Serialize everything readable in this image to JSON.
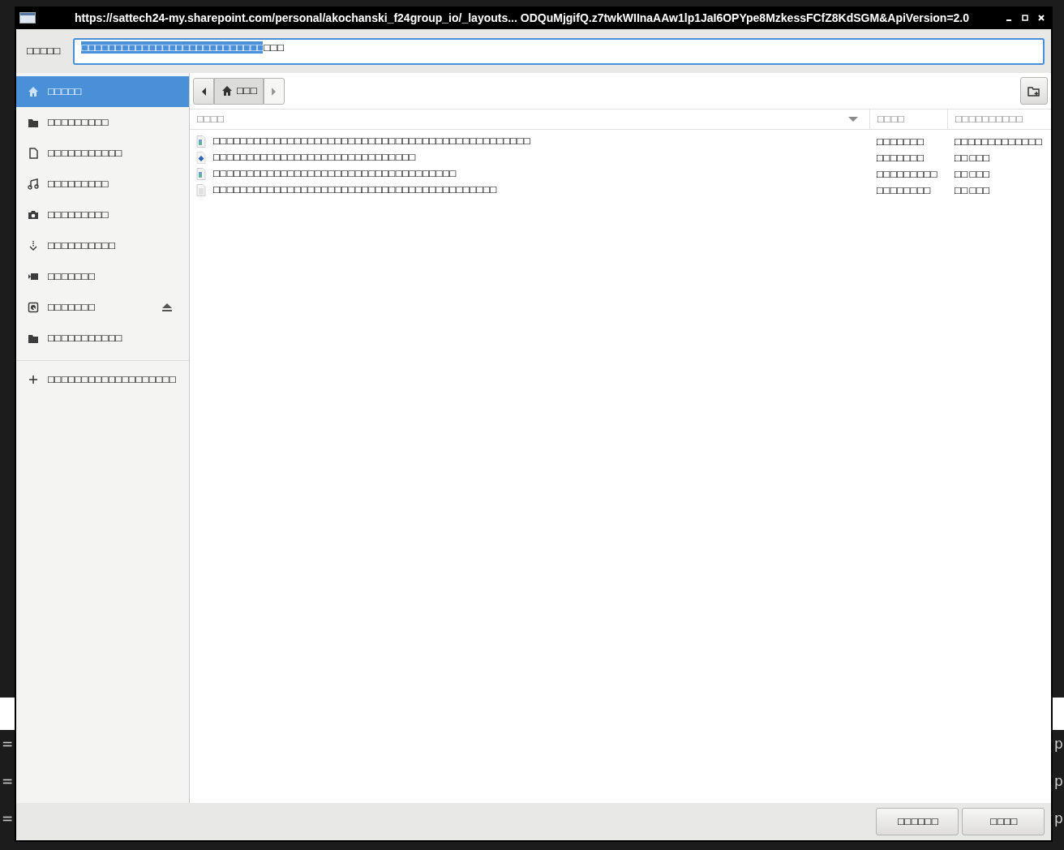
{
  "background": {
    "left_fragments": [
      "=",
      "=",
      "="
    ],
    "right_fragments": [
      "p",
      "p",
      "p"
    ]
  },
  "window": {
    "title": "https://sattech24-my.sharepoint.com/personal/akochanski_f24group_io/_layouts... ODQuMjgifQ.z7twkWIInaAAw1lp1JaI6OPYpe8MzkessFCfZ8KdSGM&ApiVersion=2.0"
  },
  "location": {
    "label": "□□□□□",
    "value_selected": "□□□□□□□□□□□□□□□□□□□□□□□□□□□",
    "value_rest": "□□□"
  },
  "sidebar": {
    "items": [
      {
        "kind": "home",
        "label": "□□□□□",
        "selected": true,
        "eject": false
      },
      {
        "kind": "folder",
        "label": "□□□□□□□□□",
        "selected": false,
        "eject": false
      },
      {
        "kind": "document",
        "label": "□□□□□□□□□□□",
        "selected": false,
        "eject": false
      },
      {
        "kind": "music",
        "label": "□□□□□□□□□",
        "selected": false,
        "eject": false
      },
      {
        "kind": "camera",
        "label": "□□□□□□□□□",
        "selected": false,
        "eject": false
      },
      {
        "kind": "download",
        "label": "□□□□□□□□□□",
        "selected": false,
        "eject": false
      },
      {
        "kind": "video",
        "label": "□□□□□□□",
        "selected": false,
        "eject": false
      },
      {
        "kind": "drive",
        "label": "□□□□□□□",
        "selected": false,
        "eject": true
      },
      {
        "kind": "folder",
        "label": "□□□□□□□□□□□",
        "selected": false,
        "eject": false
      }
    ],
    "add_item": {
      "label": "□□□□□□□□□□□□□□□□□□□"
    }
  },
  "pathbar": {
    "home_label": "□□□"
  },
  "table": {
    "columns": [
      {
        "label": "□□□□",
        "sorted": true
      },
      {
        "label": "□□□□",
        "sorted": false
      },
      {
        "label": "□□□□□□□□□□",
        "sorted": false
      }
    ],
    "rows": [
      {
        "kind": "image",
        "name": "□□□□□□□□□□□□□□□□□□□□□□□□□□□□□□□□□□□□□□□□□□□□□□□",
        "size": "□□□□□□□",
        "modified": "□□□□□□□□□□□□□"
      },
      {
        "kind": "web",
        "name": "□□□□□□□□□□□□□□□□□□□□□□□□□□□□□□",
        "size": "□□□□□□□",
        "modified": "□□ □□□"
      },
      {
        "kind": "image",
        "name": "□□□□□□□□□□□□□□□□□□□□□□□□□□□□□□□□□□□□",
        "size": "□□□□□□□□□",
        "modified": "□□ □□□"
      },
      {
        "kind": "text",
        "name": "□□□□□□□□□□□□□□□□□□□□□□□□□□□□□□□□□□□□□□□□□□",
        "size": "□□□□□□□□",
        "modified": "□□ □□□"
      }
    ]
  },
  "buttons": [
    {
      "label": "□□□□□□"
    },
    {
      "label": "□□□□"
    }
  ]
}
